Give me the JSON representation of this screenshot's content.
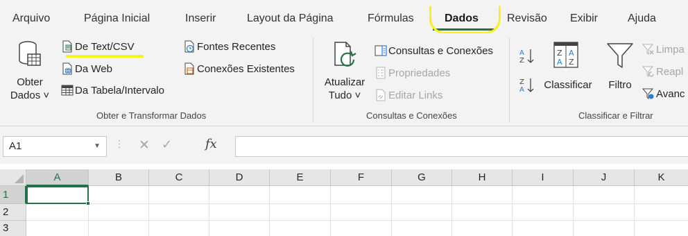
{
  "tabs": [
    "Arquivo",
    "Página Inicial",
    "Inserir",
    "Layout da Página",
    "Fórmulas",
    "Dados",
    "Revisão",
    "Exibir",
    "Ajuda"
  ],
  "active_tab": "Dados",
  "ribbon": {
    "get_data": {
      "obter_line1": "Obter",
      "obter_line2": "Dados ˅",
      "from_text": "De Text/CSV",
      "from_web": "Da Web",
      "from_table": "Da Tabela/Intervalo",
      "recent_sources": "Fontes Recentes",
      "existing_connections": "Conexões Existentes",
      "group_label": "Obter e Transformar Dados"
    },
    "queries": {
      "refresh_line1": "Atualizar",
      "refresh_line2": "Tudo ˅",
      "queries_connections": "Consultas e Conexões",
      "properties": "Propriedades",
      "edit_links": "Editar Links",
      "group_label": "Consultas e Conexões"
    },
    "sort_filter": {
      "sort": "Classificar",
      "filter": "Filtro",
      "clear": "Limpa",
      "reapply": "Reapl",
      "advanced": "Avanc",
      "group_label": "Classificar e Filtrar"
    }
  },
  "formula_bar": {
    "name_box": "A1",
    "fx": "fx",
    "value": ""
  },
  "grid": {
    "columns": [
      "A",
      "B",
      "C",
      "D",
      "E",
      "F",
      "G",
      "H",
      "I",
      "J",
      "K"
    ],
    "rows": [
      "1",
      "2",
      "3"
    ],
    "active_cell": "A1"
  },
  "colors": {
    "excel_green": "#217346",
    "highlight_yellow": "#f5f21d"
  }
}
